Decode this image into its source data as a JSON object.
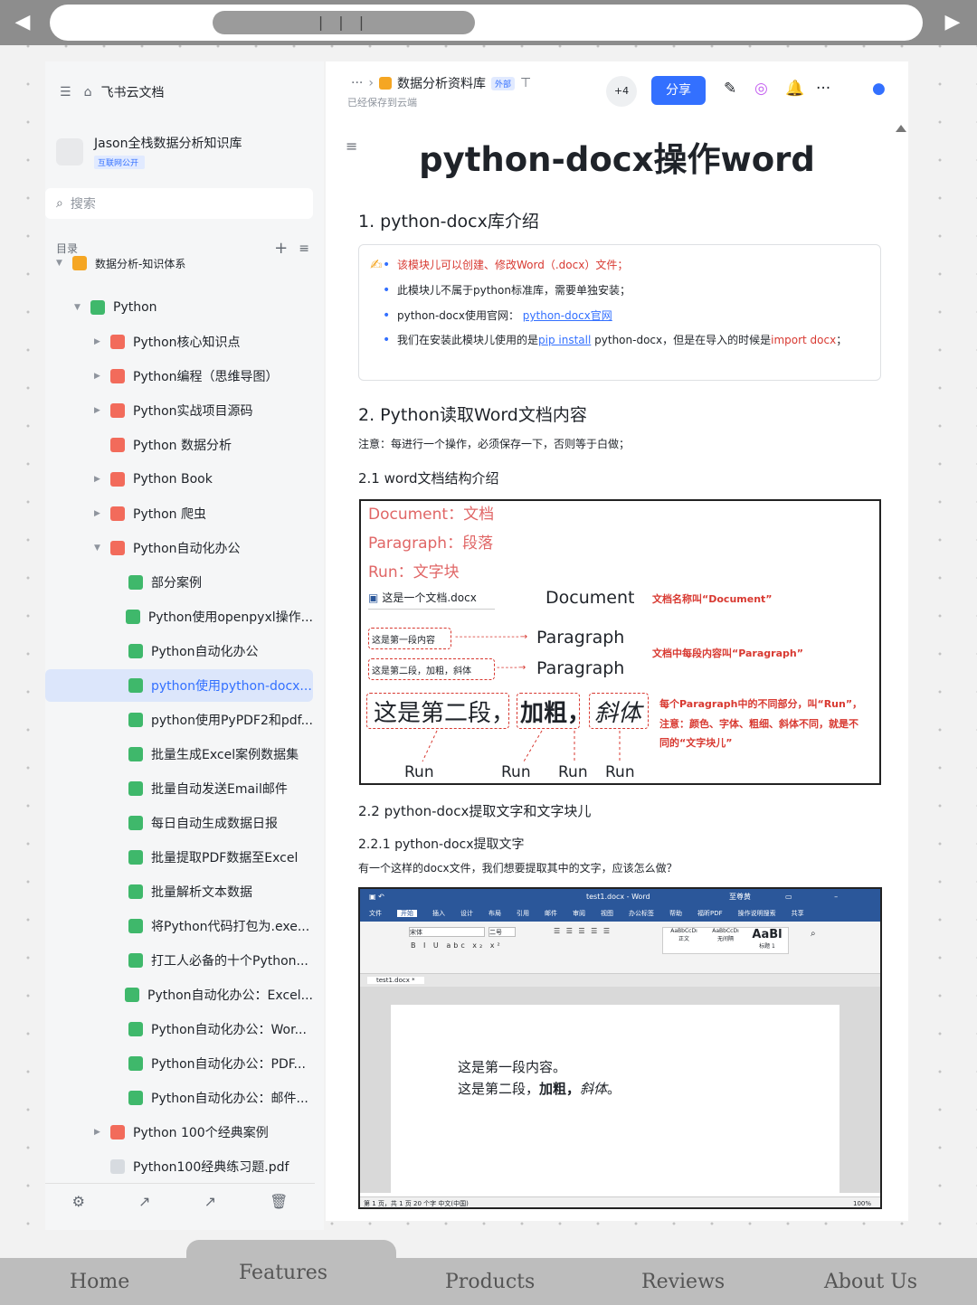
{
  "browser": {
    "back": "◀",
    "forward": "▶",
    "scroll_grip": "| | |"
  },
  "sidebar": {
    "app_name": "飞书云文档",
    "space_name": "Jason全栈数据分析知识库",
    "space_badge": "互联网公开",
    "search_placeholder": "搜索",
    "toc_label": "目录",
    "items": [
      {
        "label": "数据分析-知识体系",
        "level": 0
      },
      {
        "label": "Python",
        "level": 1
      },
      {
        "label": "Python核心知识点",
        "level": 2
      },
      {
        "label": "Python编程（思维导图）",
        "level": 2
      },
      {
        "label": "Python实战项目源码",
        "level": 2
      },
      {
        "label": "Python 数据分析",
        "level": 2
      },
      {
        "label": "Python Book",
        "level": 2
      },
      {
        "label": "Python 爬虫",
        "level": 2
      },
      {
        "label": "Python自动化办公",
        "level": 2
      },
      {
        "label": "部分案例",
        "level": 3
      },
      {
        "label": "Python使用openpyxl操作...",
        "level": 3
      },
      {
        "label": "Python自动化办公",
        "level": 3
      },
      {
        "label": "python使用python-docx...",
        "level": 3,
        "active": true
      },
      {
        "label": "python使用PyPDF2和pdf...",
        "level": 3
      },
      {
        "label": "批量生成Excel案例数据集",
        "level": 3
      },
      {
        "label": "批量自动发送Email邮件",
        "level": 3
      },
      {
        "label": "每日自动生成数据日报",
        "level": 3
      },
      {
        "label": "批量提取PDF数据至Excel",
        "level": 3
      },
      {
        "label": "批量解析文本数据",
        "level": 3
      },
      {
        "label": "将Python代码打包为.exe...",
        "level": 3
      },
      {
        "label": "打工人必备的十个Python...",
        "level": 3
      },
      {
        "label": "Python自动化办公：Excel...",
        "level": 3
      },
      {
        "label": "Python自动化办公：Wor...",
        "level": 3
      },
      {
        "label": "Python自动化办公：PDF...",
        "level": 3
      },
      {
        "label": "Python自动化办公：邮件...",
        "level": 3
      },
      {
        "label": "Python 100个经典案例",
        "level": 2
      },
      {
        "label": "Python100经典练习题.pdf",
        "level": 2
      }
    ]
  },
  "header": {
    "breadcrumb_more": "···",
    "doc_location": "数据分析资料库",
    "external_tag": "外部",
    "saved_status": "已经保存到云端",
    "collaborators": "+4",
    "share_label": "分享"
  },
  "doc": {
    "title": "python-docx操作word",
    "s1": "1. python-docx库介绍",
    "b1": "该模块儿可以创建、修改Word（.docx）文件；",
    "b2": "此模块儿不属于python标准库，需要单独安装；",
    "b3_pre": "python-docx使用官网：",
    "b3_link": "python-docx官网",
    "b4_a": "我们在安装此模块儿使用的是",
    "b4_link": "pip install",
    "b4_b": " python-docx，但是在导入的时候是",
    "b4_c": "import docx",
    "b4_d": "；",
    "s2": "2. Python读取Word文档内容",
    "note": "注意：每进行一个操作，必须保存一下，否则等于白做；",
    "s21": "2.1 word文档结构介绍",
    "s22": "2.2 python-docx提取文字和文字块儿",
    "s221": "2.2.1 python-docx提取文字",
    "q": "有一个这样的docx文件，我们想要提取其中的文字，应该怎么做？"
  },
  "fig1": {
    "l1": "Document：文档",
    "l2": "Paragraph：段落",
    "l3": "Run：文字块",
    "file": "这是一个文档.docx",
    "document": "Document",
    "doc_note": "文档名称叫“Document”",
    "p1": "这是第一段内容",
    "p2": "这是第二段，加粗，斜体",
    "paragraph": "Paragraph",
    "para_note": "文档中每段内容叫“Paragraph”",
    "run1": "这是第二段，",
    "run2": "加粗，",
    "run3": "斜体",
    "run_note1": "每个Paragraph中的不同部分，叫“Run”，",
    "run_note2": "注意：颜色、字体、粗细、斜体不同，就是不",
    "run_note3": "同的“文字块儿”",
    "run": "Run"
  },
  "fig2": {
    "window_title": "test1.docx  -  Word",
    "user": "至尊黄",
    "ribbon_tabs": [
      "文件",
      "开始",
      "插入",
      "设计",
      "布局",
      "引用",
      "邮件",
      "审阅",
      "视图",
      "办公标签",
      "帮助",
      "福昕PDF",
      "操作说明搜索",
      "共享"
    ],
    "doc_tab": "test1.docx *",
    "font": "宋体",
    "size": "二号",
    "styles": [
      "AaBbCcDı",
      "AaBbCcDı",
      "AaBl"
    ],
    "style_names": [
      "正文",
      "无间隔",
      "标题 1"
    ],
    "line1": "这是第一段内容。",
    "line2_a": "这是第二段，",
    "line2_b": "加粗，",
    "line2_c": "斜体",
    "line2_d": "。",
    "status": "第 1 页，共 1 页    20 个字    中文(中国)",
    "zoom": "100%"
  },
  "bottom_nav": {
    "items": [
      "Home",
      "Features",
      "Products",
      "Reviews",
      "About Us"
    ]
  }
}
